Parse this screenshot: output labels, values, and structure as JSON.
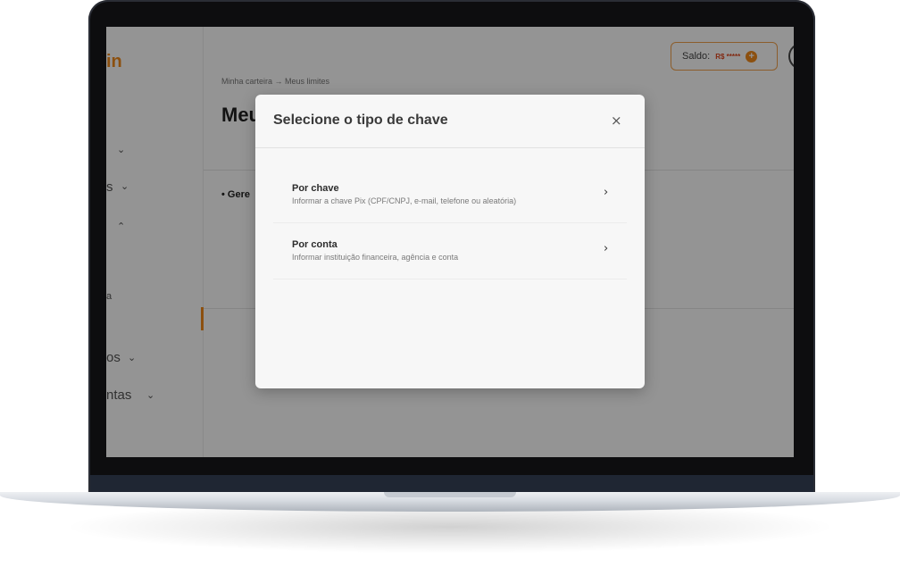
{
  "sidebar": {
    "logo_fragment": "in",
    "items": [
      {
        "label": "",
        "chevron": "⌄"
      },
      {
        "label": "s",
        "chevron": "⌄"
      },
      {
        "label": "",
        "chevron": "⌃"
      },
      {
        "label": "a",
        "chevron": ""
      },
      {
        "label": "os",
        "chevron": "⌄"
      },
      {
        "label": "ntas",
        "chevron": "⌄"
      }
    ],
    "collapse_glyph": "<"
  },
  "header": {
    "saldo_label": "Saldo:",
    "saldo_value": "R$ *****",
    "plus_glyph": "+"
  },
  "main": {
    "breadcrumb": "Minha carteira → Meus limites",
    "title_fragment": "Meu",
    "section_fragment": "• Gere"
  },
  "modal": {
    "title": "Selecione o tipo de chave",
    "close_glyph": "×",
    "options": [
      {
        "title": "Por chave",
        "description": "Informar a chave Pix (CPF/CNPJ, e-mail, telefone ou aleatória)",
        "chevron": "›"
      },
      {
        "title": "Por conta",
        "description": "Informar instituição financeira, agência e conta",
        "chevron": "›"
      }
    ]
  },
  "colors": {
    "accent": "#f28a1a",
    "saldo_value": "#e0471e",
    "overlay": "rgba(0,0,0,0.42)"
  }
}
